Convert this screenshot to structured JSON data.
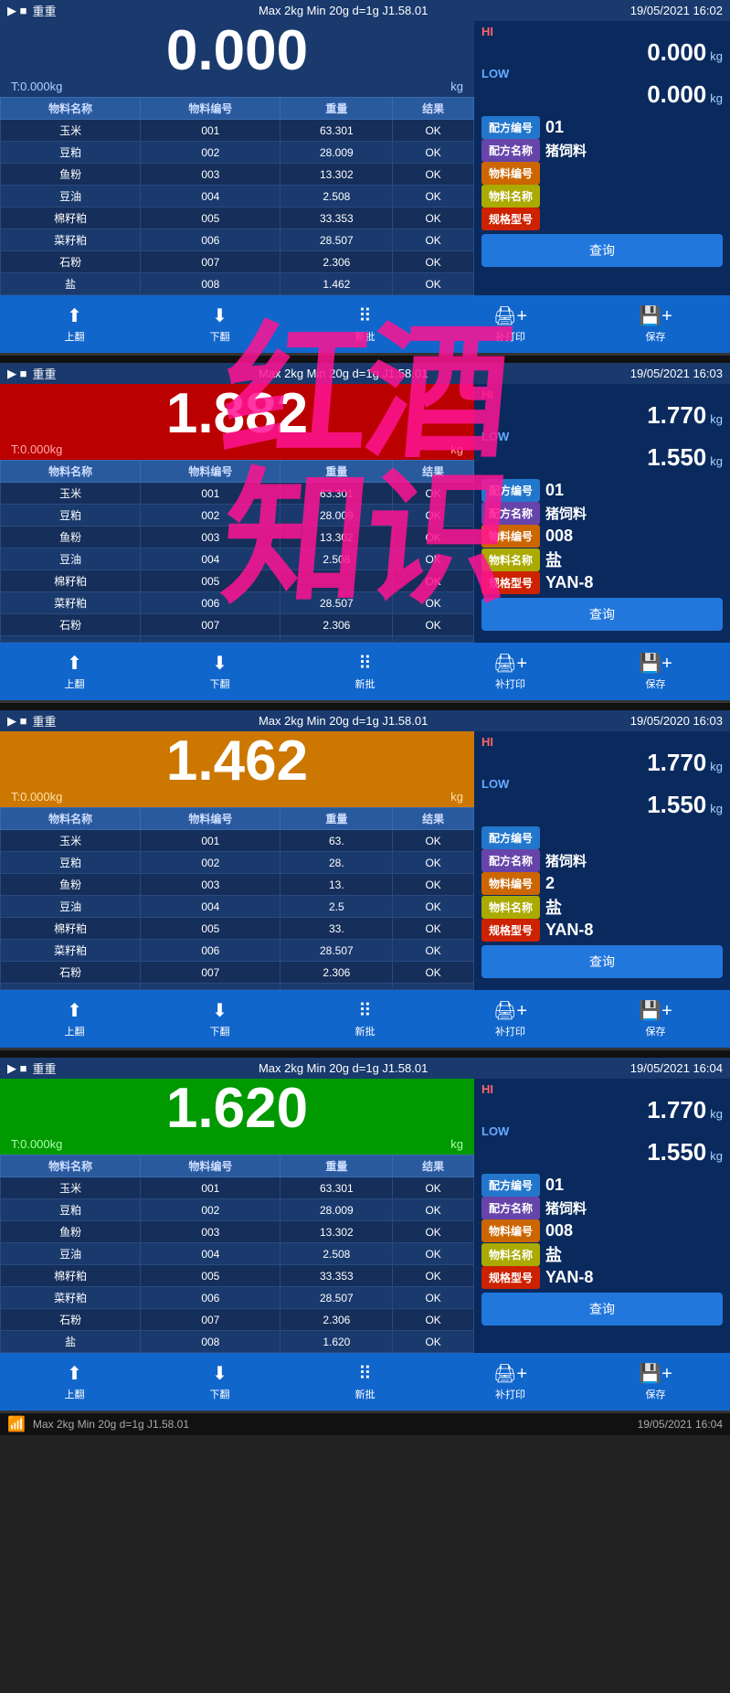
{
  "panels": [
    {
      "id": "panel1",
      "status_bar": {
        "left_icons": "▶ ■",
        "spec": "Max 2kg  Min 20g  d=1g  J1.58.01",
        "datetime": "19/05/2021  16:02"
      },
      "weight": "0.000",
      "weight_bg": "normal",
      "unit": "kg",
      "tare": "T:0.000kg",
      "hi_value": "0.000",
      "low_value": "0.000",
      "table": {
        "headers": [
          "物料名称",
          "物料编号",
          "重量",
          "结果"
        ],
        "rows": [
          [
            "玉米",
            "001",
            "63.301",
            "OK"
          ],
          [
            "豆粕",
            "002",
            "28.009",
            "OK"
          ],
          [
            "鱼粉",
            "003",
            "13.302",
            "OK"
          ],
          [
            "豆油",
            "004",
            "2.508",
            "OK"
          ],
          [
            "棉籽粕",
            "005",
            "33.353",
            "OK"
          ],
          [
            "菜籽粕",
            "006",
            "28.507",
            "OK"
          ],
          [
            "石粉",
            "007",
            "2.306",
            "OK"
          ],
          [
            "盐",
            "008",
            "1.462",
            "OK"
          ]
        ]
      },
      "right_info": {
        "formula_no_label": "配方编号",
        "formula_no_value": "01",
        "formula_name_label": "配方名称",
        "formula_name_value": "猪饲料",
        "material_no_label": "物料编号",
        "material_no_value": "",
        "material_name_label": "物料名称",
        "material_name_value": "",
        "spec_label": "规格型号",
        "spec_value": "",
        "query_label": "查询"
      },
      "toolbar": {
        "btn1": "上翻",
        "btn2": "下翻",
        "btn3": "新批",
        "btn4": "补打印",
        "btn5": "保存"
      }
    },
    {
      "id": "panel2",
      "status_bar": {
        "left_icons": "▶ ■",
        "spec": "Max 2kg  Min 20g  d=1g  J1.58.01",
        "datetime": "19/05/2021  16:03"
      },
      "weight": "1.882",
      "weight_bg": "red",
      "unit": "kg",
      "tare": "T:0.000kg",
      "hi_value": "1.770",
      "low_value": "1.550",
      "table": {
        "headers": [
          "物料名称",
          "物料编号",
          "重量",
          "结果"
        ],
        "rows": [
          [
            "玉米",
            "001",
            "63.301",
            "OK"
          ],
          [
            "豆粕",
            "002",
            "28.009",
            "OK"
          ],
          [
            "鱼粉",
            "003",
            "13.302",
            "OK"
          ],
          [
            "豆油",
            "004",
            "2.508",
            "OK"
          ],
          [
            "棉籽粕",
            "005",
            "",
            "OK"
          ],
          [
            "菜籽粕",
            "006",
            "28.507",
            "OK"
          ],
          [
            "石粉",
            "007",
            "2.306",
            "OK"
          ],
          [
            "",
            "",
            "",
            ""
          ]
        ]
      },
      "right_info": {
        "formula_no_label": "配方编号",
        "formula_no_value": "01",
        "formula_name_label": "配方名称",
        "formula_name_value": "猪饲料",
        "material_no_label": "物料编号",
        "material_no_value": "008",
        "material_name_label": "物料名称",
        "material_name_value": "盐",
        "spec_label": "规格型号",
        "spec_value": "YAN-8",
        "query_label": "查询"
      },
      "toolbar": {
        "btn1": "上翻",
        "btn2": "下翻",
        "btn3": "新批",
        "btn4": "补打印",
        "btn5": "保存"
      }
    },
    {
      "id": "panel3",
      "status_bar": {
        "left_icons": "▶ ■",
        "spec": "Max 2kg  Min 20g  d=1g  J1.58.01",
        "datetime": "19/05/2020  16:03"
      },
      "weight": "1.462",
      "weight_bg": "orange",
      "unit": "kg",
      "tare": "T:0.000kg",
      "hi_value": "1.770",
      "low_value": "1.550",
      "table": {
        "headers": [
          "物料名称",
          "物料编号",
          "重量",
          "结果"
        ],
        "rows": [
          [
            "玉米",
            "001",
            "63.",
            "OK"
          ],
          [
            "豆粕",
            "002",
            "28.",
            "OK"
          ],
          [
            "鱼粉",
            "003",
            "13.",
            "OK"
          ],
          [
            "豆油",
            "004",
            "2.5",
            "OK"
          ],
          [
            "棉籽粕",
            "005",
            "33.",
            "OK"
          ],
          [
            "菜籽粕",
            "006",
            "28.507",
            "OK"
          ],
          [
            "石粉",
            "007",
            "2.306",
            "OK"
          ],
          [
            "",
            "",
            "",
            ""
          ]
        ]
      },
      "right_info": {
        "formula_no_label": "配方编号",
        "formula_no_value": "",
        "formula_name_label": "配方名称",
        "formula_name_value": "猪饲料",
        "material_no_label": "物料编号",
        "material_no_value": "2",
        "material_name_label": "物料名称",
        "material_name_value": "盐",
        "spec_label": "规格型号",
        "spec_value": "YAN-8",
        "query_label": "查询"
      },
      "toolbar": {
        "btn1": "上翻",
        "btn2": "下翻",
        "btn3": "新批",
        "btn4": "补打印",
        "btn5": "保存"
      }
    },
    {
      "id": "panel4",
      "status_bar": {
        "left_icons": "▶ ■",
        "spec": "Max 2kg  Min 20g  d=1g  J1.58.01",
        "datetime": "19/05/2021  16:04"
      },
      "weight": "1.620",
      "weight_bg": "green",
      "unit": "kg",
      "tare": "T:0.000kg",
      "hi_value": "1.770",
      "low_value": "1.550",
      "table": {
        "headers": [
          "物料名称",
          "物料编号",
          "重量",
          "结果"
        ],
        "rows": [
          [
            "玉米",
            "001",
            "63.301",
            "OK"
          ],
          [
            "豆粕",
            "002",
            "28.009",
            "OK"
          ],
          [
            "鱼粉",
            "003",
            "13.302",
            "OK"
          ],
          [
            "豆油",
            "004",
            "2.508",
            "OK"
          ],
          [
            "棉籽粕",
            "005",
            "33.353",
            "OK"
          ],
          [
            "菜籽粕",
            "006",
            "28.507",
            "OK"
          ],
          [
            "石粉",
            "007",
            "2.306",
            "OK"
          ],
          [
            "盐",
            "008",
            "1.620",
            "OK"
          ]
        ]
      },
      "right_info": {
        "formula_no_label": "配方编号",
        "formula_no_value": "01",
        "formula_name_label": "配方名称",
        "formula_name_value": "猪饲料",
        "material_no_label": "物料编号",
        "material_no_value": "008",
        "material_name_label": "物料名称",
        "material_name_value": "盐",
        "spec_label": "规格型号",
        "spec_value": "YAN-8",
        "query_label": "查询"
      },
      "toolbar": {
        "btn1": "上翻",
        "btn2": "下翻",
        "btn3": "新批",
        "btn4": "补打印",
        "btn5": "保存"
      }
    }
  ],
  "bottom_bar": {
    "spec": "Max 2kg  Min 20g  d=1g  J1.58.01",
    "datetime": "19/05/2021  16:04"
  },
  "watermark": {
    "line1": "红酒",
    "line2": "知识"
  }
}
